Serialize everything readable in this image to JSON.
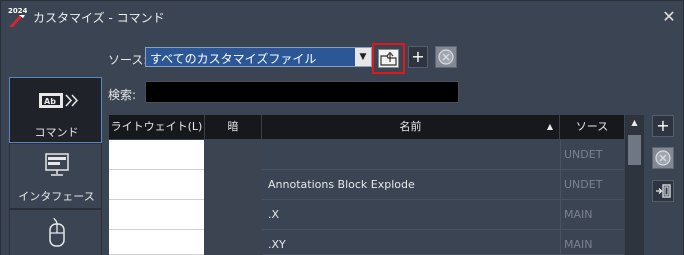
{
  "window": {
    "title": "カスタマイズ - コマンド",
    "logo_text": "2024"
  },
  "source": {
    "label": "ソース:",
    "selected": "すべてのカスタマイズファイル"
  },
  "search": {
    "label": "検索:",
    "value": ""
  },
  "categories": [
    {
      "label": "コマンド",
      "icon": "ab-command-icon",
      "active": true
    },
    {
      "label": "インタフェース",
      "icon": "monitor-icon",
      "active": false
    },
    {
      "label": "",
      "icon": "mouse-icon",
      "active": false
    }
  ],
  "table": {
    "columns": [
      "ライトウェイト(L)",
      "暗",
      "名前",
      "ソース"
    ],
    "sort_column": "名前",
    "rows": [
      {
        "name": "",
        "source": "UNDET"
      },
      {
        "name": "Annotations Block Explode",
        "source": "UNDET"
      },
      {
        "name": ".X",
        "source": "MAIN"
      },
      {
        "name": ".XY",
        "source": "MAIN"
      }
    ]
  },
  "colors": {
    "window_bg": "#3b4453",
    "highlight_border": "#e21818",
    "select_bg": "#2b5797"
  }
}
